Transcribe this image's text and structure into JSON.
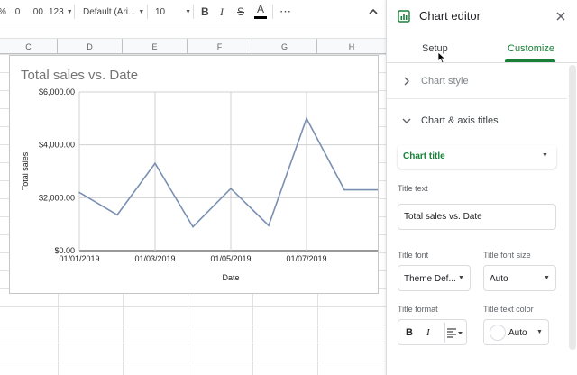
{
  "toolbar": {
    "percent": "%",
    "dec_less": ".0",
    "dec_more": ".00",
    "more_formats": "123",
    "font": "Default (Ari...",
    "font_size": "10",
    "bold": "B",
    "italic": "I",
    "strike": "S",
    "text_color": "A",
    "more": "⋯",
    "collapse": "^"
  },
  "columns": [
    "C",
    "D",
    "E",
    "F",
    "G",
    "H"
  ],
  "chart_data": {
    "type": "line",
    "title": "Total sales vs. Date",
    "xlabel": "Date",
    "ylabel": "Total sales",
    "ylim": [
      0,
      6000
    ],
    "y_ticks": [
      "$6,000.00",
      "$4,000.00",
      "$2,000.00",
      "$0.00"
    ],
    "x_ticks": [
      "01/01/2019",
      "01/03/2019",
      "01/05/2019",
      "01/07/2019"
    ],
    "series": [
      {
        "values": [
          2200,
          1350,
          3300,
          900,
          2350,
          950,
          5000,
          2300,
          2300
        ],
        "color": "#7a90b3"
      }
    ],
    "grid": true
  },
  "panel": {
    "title": "Chart editor",
    "tabs": [
      {
        "label": "Setup",
        "active": false
      },
      {
        "label": "Customize",
        "active": true
      }
    ],
    "sections": {
      "chart_style": "Chart style",
      "axis_titles": "Chart & axis titles"
    },
    "title_select": "Chart title",
    "title_text_label": "Title text",
    "title_text_value": "Total sales vs. Date",
    "title_font_label": "Title font",
    "title_font_value": "Theme Def...",
    "title_font_size_label": "Title font size",
    "title_font_size_value": "Auto",
    "title_format_label": "Title format",
    "title_text_color_label": "Title text color",
    "title_text_color_value": "Auto",
    "format_bold": "B",
    "format_italic": "I",
    "accent": "#188038"
  }
}
